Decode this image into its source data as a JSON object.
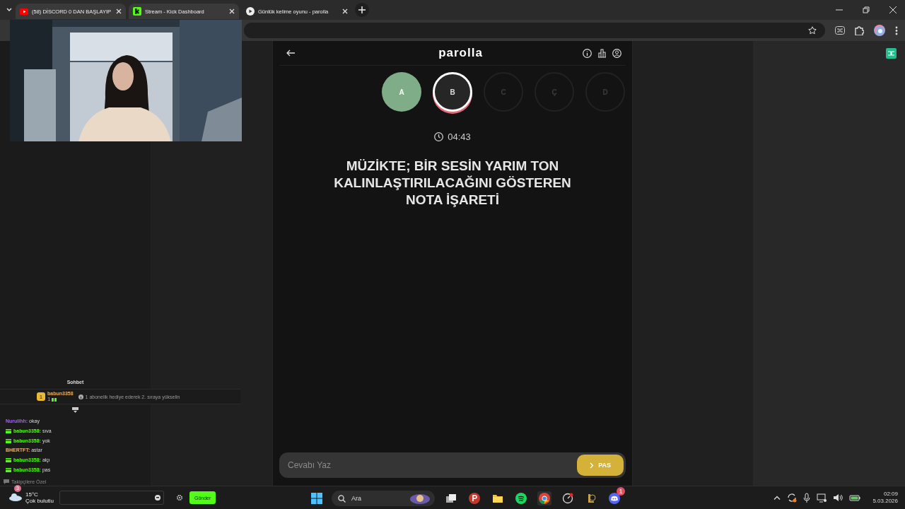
{
  "browser": {
    "tabs": [
      {
        "title": "(58) DİSCORD 0 DAN BAŞLAYIP",
        "selected": false
      },
      {
        "title": "Stream - Kick Dashboard",
        "selected": false
      },
      {
        "title": "Günlük kelime oyunu - parolla",
        "selected": true
      }
    ]
  },
  "chat": {
    "title": "Sohbet",
    "pinned": {
      "user": "babun3358",
      "rank": "1",
      "count": "1",
      "note": "1 abonelik hediye ederek 2. sıraya yükselin"
    },
    "messages": [
      {
        "user": "Nurulihh:",
        "color": "#a463ff",
        "gift": false,
        "text": "okay"
      },
      {
        "user": "babun3358:",
        "color": "#53fc18",
        "gift": true,
        "text": "sıva"
      },
      {
        "user": "babun3358:",
        "color": "#53fc18",
        "gift": true,
        "text": "yok"
      },
      {
        "user": "BHERTFT:",
        "color": "#e3b37a",
        "gift": false,
        "text": "astar"
      },
      {
        "user": "babun3358:",
        "color": "#53fc18",
        "gift": true,
        "text": "alçı"
      },
      {
        "user": "babun3358:",
        "color": "#53fc18",
        "gift": true,
        "text": "pas"
      }
    ],
    "mode": "Takipçilere Özel",
    "send": "Gönder"
  },
  "game": {
    "title": "parolla",
    "letters": [
      {
        "letter": "A",
        "kind": "correct"
      },
      {
        "letter": "B",
        "kind": "current"
      },
      {
        "letter": "C",
        "kind": "pending"
      },
      {
        "letter": "Ç",
        "kind": "pending"
      },
      {
        "letter": "D",
        "kind": "pending"
      }
    ],
    "timer": "04:43",
    "question": "MÜZİKTE; BİR SESİN YARIM TON KALINLAŞTIRILACAĞINI GÖSTEREN NOTA İŞARETİ",
    "answer": {
      "placeholder": "Cevabı Yaz"
    },
    "pass": "PAS"
  },
  "taskbar": {
    "weather": {
      "temp": "15°C",
      "desc": "Çok bulutlu",
      "badge": "3"
    },
    "search": "Ara",
    "discord_badge": "1",
    "time": "02:09",
    "date": "5.03.2026"
  }
}
